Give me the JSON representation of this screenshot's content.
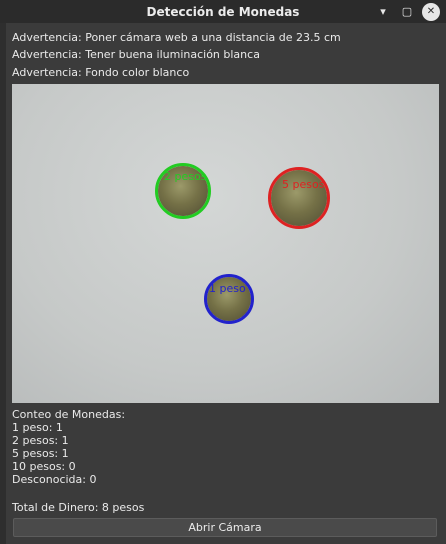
{
  "window": {
    "title": "Detección de Monedas",
    "buttons": {
      "minimize": "▾",
      "maximize": "▢",
      "close": "✕"
    }
  },
  "warnings": [
    "Advertencia: Poner cámara web a una distancia de 23.5 cm",
    "Advertencia: Tener buena iluminación blanca",
    "Advertencia: Fondo color blanco"
  ],
  "camera": {
    "coins": [
      {
        "label": "2 pesos",
        "color": "#22cc22"
      },
      {
        "label": "5 pesos",
        "color": "#dd2222"
      },
      {
        "label": "1 peso",
        "color": "#2222cc"
      }
    ]
  },
  "count": {
    "header": "Conteo de Monedas:",
    "lines": [
      "1 peso: 1",
      "2 pesos: 1",
      "5 pesos: 1",
      "10 pesos: 0",
      "Desconocida: 0"
    ]
  },
  "total": "Total de Dinero: 8 pesos",
  "open_camera_label": "Abrir Cámara"
}
